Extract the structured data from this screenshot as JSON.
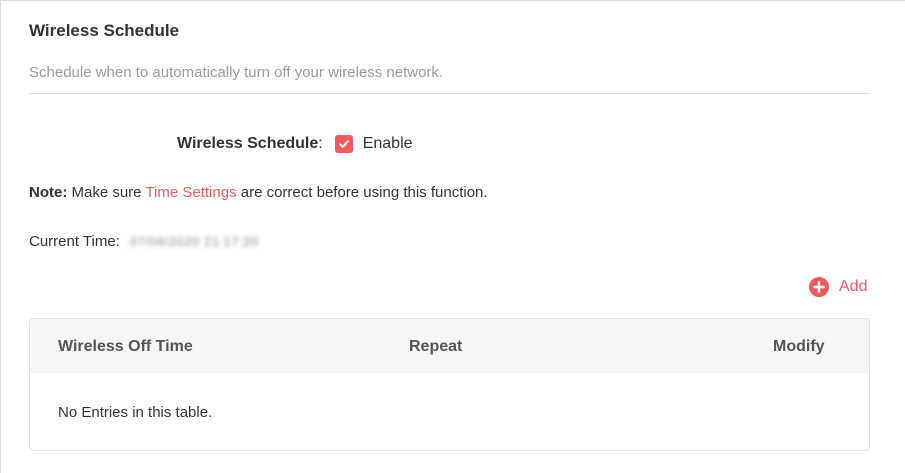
{
  "section": {
    "title": "Wireless Schedule",
    "description": "Schedule when to automatically turn off your wireless network."
  },
  "schedule": {
    "label": "Wireless Schedule",
    "colon": ":",
    "enable_label": "Enable",
    "enabled": true
  },
  "note": {
    "prefix": "Note:",
    "before_link": " Make sure ",
    "link_text": "Time Settings",
    "after_link": " are correct before using this function."
  },
  "current_time": {
    "label": "Current Time:",
    "value": "07/06/2020 21:17:20"
  },
  "add_button": {
    "label": "Add",
    "icon": "plus-circle-icon"
  },
  "table": {
    "columns": [
      "Wireless Off Time",
      "Repeat",
      "Modify"
    ],
    "empty_text": "No Entries in this table."
  },
  "colors": {
    "accent": "#f15a5a",
    "header_bg": "#f6f6f6",
    "muted_text": "#9a9a9a"
  }
}
